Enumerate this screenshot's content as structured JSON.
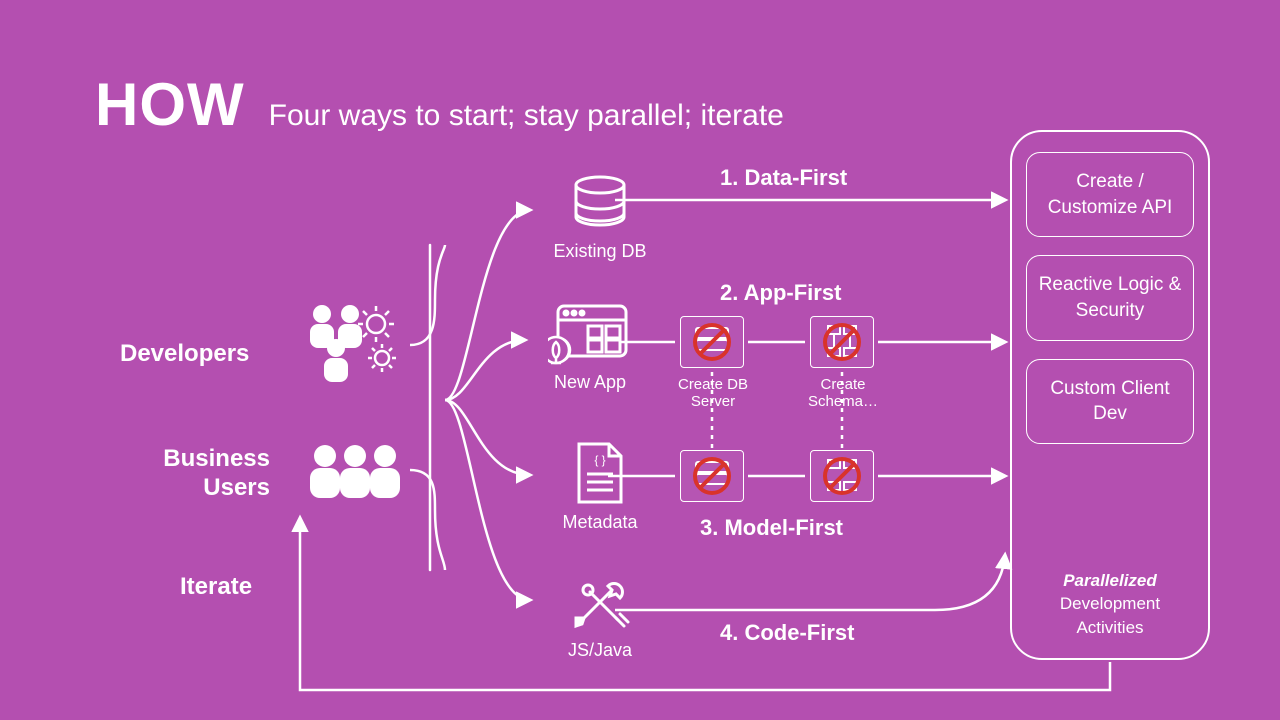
{
  "title": {
    "main": "HOW",
    "sub": "Four ways to start; stay parallel; iterate"
  },
  "roles": {
    "developers": "Developers",
    "business_users": "Business Users"
  },
  "iterate_label": "Iterate",
  "sources": {
    "existing_db": "Existing DB",
    "new_app": "New App",
    "metadata": "Metadata",
    "js_java": "JS/Java"
  },
  "paths": {
    "data_first": "1. Data-First",
    "app_first": "2. App-First",
    "model_first": "3. Model-First",
    "code_first": "4. Code-First"
  },
  "skip": {
    "create_db_server": "Create DB Server",
    "create_schema": "Create Schema…"
  },
  "right": {
    "box1": "Create / Customize API",
    "box2": "Reactive Logic & Security",
    "box3": "Custom Client Dev",
    "footer_em": "Parallelized",
    "footer_rest": "Development Activities"
  }
}
